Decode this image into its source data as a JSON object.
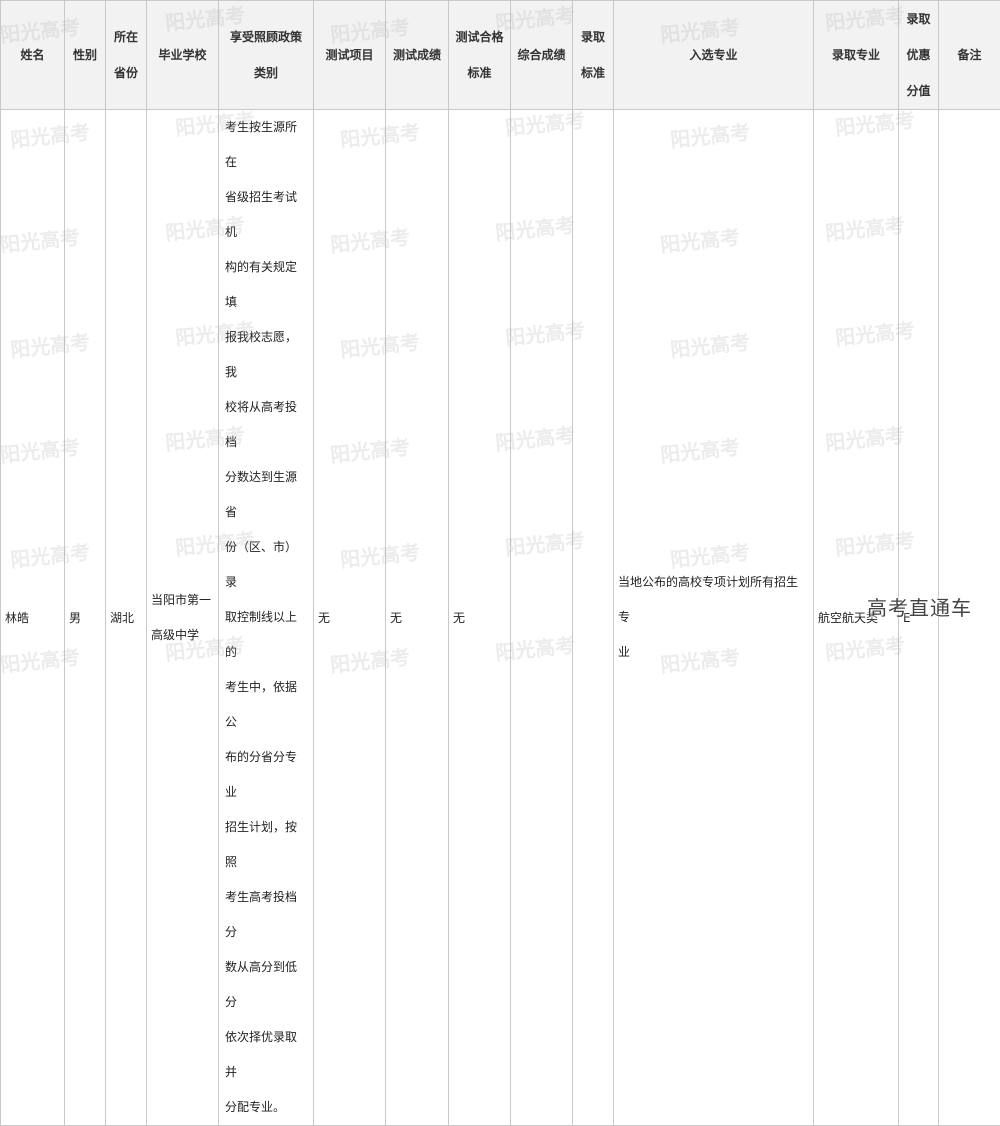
{
  "headers": {
    "name": "姓名",
    "gender": "性别",
    "province_l1": "所在",
    "province_l2": "省份",
    "school": "毕业学校",
    "policy_l1": "享受照顾政策",
    "policy_l2": "类别",
    "test_item": "测试项目",
    "test_score": "测试成绩",
    "pass_l1": "测试合格",
    "pass_l2": "标准",
    "overall": "综合成绩",
    "admit_std_l1": "录取",
    "admit_std_l2": "标准",
    "selected_major": "入选专业",
    "admit_major": "录取专业",
    "bonus_l1": "录取",
    "bonus_l2": "优惠",
    "bonus_l3": "分值",
    "remark": "备注"
  },
  "row": {
    "name": "林皓",
    "gender": "男",
    "province": "湖北",
    "school_l1": "当阳市第一",
    "school_l2": "高级中学",
    "policy_lines": [
      "考生按生源所在",
      "省级招生考试机",
      "构的有关规定填",
      "报我校志愿，我",
      "校将从高考投档",
      "分数达到生源省",
      "份（区、市）录",
      "取控制线以上的",
      "考生中，依据公",
      "布的分省分专业",
      "招生计划，按照",
      "考生高考投档分",
      "数从高分到低分",
      "依次择优录取并",
      "分配专业。"
    ],
    "test_item": "无",
    "test_score": "无",
    "pass_std": "无",
    "overall": "",
    "admit_std": "",
    "selected_major_l1": "当地公布的高校专项计划所有招生专",
    "selected_major_l2": "业",
    "admit_major": "航空航天类",
    "bonus": "E",
    "remark": ""
  },
  "watermark_text": "阳光高考",
  "brand": "高考直通车"
}
